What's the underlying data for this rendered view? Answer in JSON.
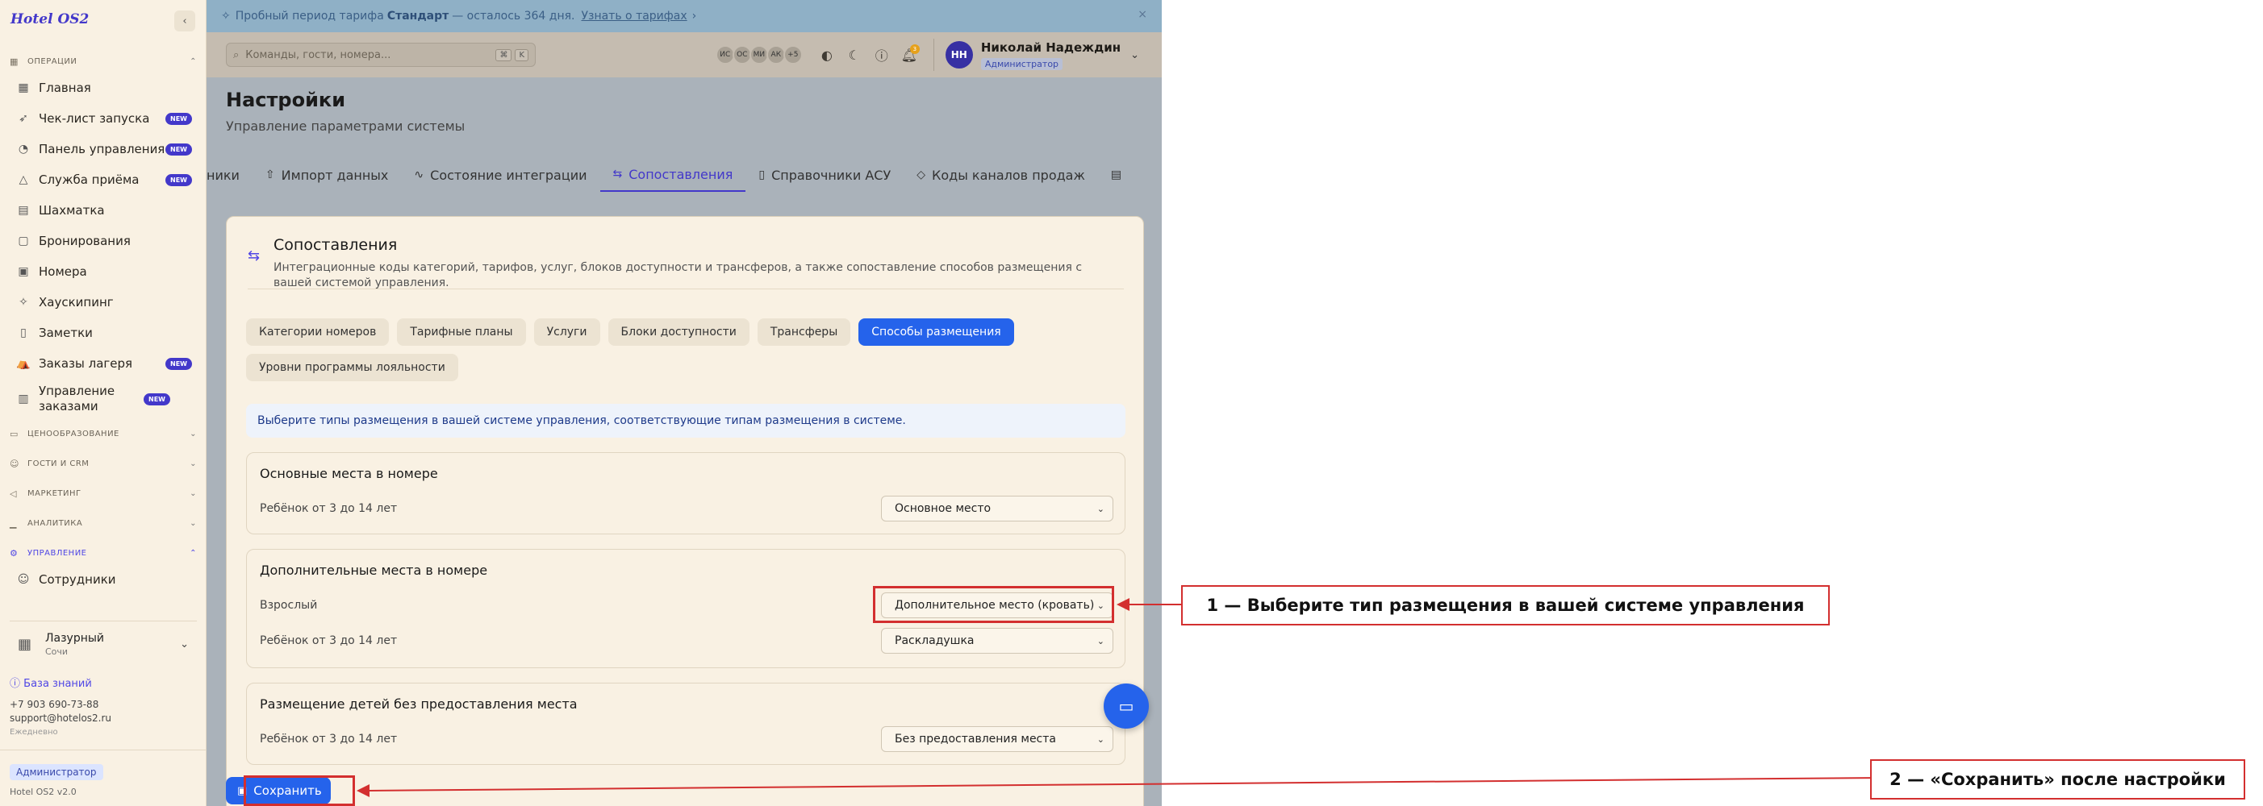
{
  "brand": "Hotel OS2",
  "sidebar": {
    "groups": [
      {
        "label": "ОПЕРАЦИИ",
        "icon": "grid-icon"
      },
      {
        "label": "ЦЕНООБРАЗОВАНИЕ",
        "icon": "price-icon"
      },
      {
        "label": "ГОСТИ И CRM",
        "icon": "users-icon"
      },
      {
        "label": "МАРКЕТИНГ",
        "icon": "megaphone-icon"
      },
      {
        "label": "АНАЛИТИКА",
        "icon": "chart-icon"
      },
      {
        "label": "УПРАВЛЕНИЕ",
        "icon": "gear-icon"
      }
    ],
    "items": [
      {
        "label": "Главная",
        "badge": ""
      },
      {
        "label": "Чек-лист запуска",
        "badge": "NEW"
      },
      {
        "label": "Панель управления",
        "badge": "NEW"
      },
      {
        "label": "Служба приёма",
        "badge": "NEW"
      },
      {
        "label": "Шахматка",
        "badge": ""
      },
      {
        "label": "Бронирования",
        "badge": ""
      },
      {
        "label": "Номера",
        "badge": ""
      },
      {
        "label": "Хаускипинг",
        "badge": ""
      },
      {
        "label": "Заметки",
        "badge": ""
      },
      {
        "label": "Заказы лагеря",
        "badge": "NEW"
      },
      {
        "label": "Управление заказами",
        "badge": "NEW"
      },
      {
        "label": "Сотрудники",
        "badge": ""
      }
    ],
    "hotel": {
      "name": "Лазурный",
      "city": "Сочи"
    },
    "contacts": {
      "knowledge_base": "База знаний",
      "phone": "+7 903 690-73-88",
      "email": "support@hotelos2.ru",
      "hours": "Ежедневно"
    },
    "role": "Администратор",
    "version": "Hotel OS2 v2.0"
  },
  "banner": {
    "prefix": "Пробный период тарифа",
    "plan": "Стандарт",
    "suffix": "— осталось 364 дня.",
    "link": "Узнать о тарифах"
  },
  "topbar": {
    "search_placeholder": "Команды, гости, номера...",
    "kbd1": "⌘",
    "kbd2": "K",
    "avatars": [
      "ИС",
      "ОС",
      "МИ",
      "АК",
      "+5"
    ],
    "notif_count": "3",
    "user_initials": "НН",
    "user_name": "Николай Надеждин",
    "user_role": "Администратор"
  },
  "page": {
    "title": "Настройки",
    "subtitle": "Управление параметрами системы",
    "tabs": [
      {
        "label": "ники",
        "icon": ""
      },
      {
        "label": "Импорт данных",
        "icon": "upload-icon"
      },
      {
        "label": "Состояние интеграции",
        "icon": "pulse-icon"
      },
      {
        "label": "Сопоставления",
        "icon": "arrows-icon"
      },
      {
        "label": "Справочники АСУ",
        "icon": "book-icon"
      },
      {
        "label": "Коды каналов продаж",
        "icon": "tag-icon"
      }
    ]
  },
  "card": {
    "title": "Сопоставления",
    "description": "Интеграционные коды категорий, тарифов, услуг, блоков доступности и трансферов, а также сопоставление способов размещения с вашей системой управления.",
    "subtabs": [
      "Категории номеров",
      "Тарифные планы",
      "Услуги",
      "Блоки доступности",
      "Трансферы",
      "Способы размещения",
      "Уровни программы лояльности"
    ],
    "info": "Выберите типы размещения в вашей системе управления, соответствующие типам размещения в системе.",
    "sections": [
      {
        "title": "Основные места в номере",
        "rows": [
          {
            "label": "Ребёнок от 3 до 14 лет",
            "value": "Основное место"
          }
        ]
      },
      {
        "title": "Дополнительные места в номере",
        "rows": [
          {
            "label": "Взрослый",
            "value": "Дополнительное место (кровать)"
          },
          {
            "label": "Ребёнок от 3 до 14 лет",
            "value": "Раскладушка"
          }
        ]
      },
      {
        "title": "Размещение детей без предоставления места",
        "rows": [
          {
            "label": "Ребёнок от 3 до 14 лет",
            "value": "Без предоставления места"
          }
        ]
      }
    ],
    "save_label": "Сохранить"
  },
  "annotations": {
    "step1": "1 — Выберите тип размещения в вашей системе управления",
    "step2": "2 — «Сохранить» после настройки"
  },
  "colors": {
    "accent": "#4338ca",
    "primary": "#2563eb",
    "annotation": "#d32f2f",
    "sidebar_bg": "#f9f1e3"
  }
}
